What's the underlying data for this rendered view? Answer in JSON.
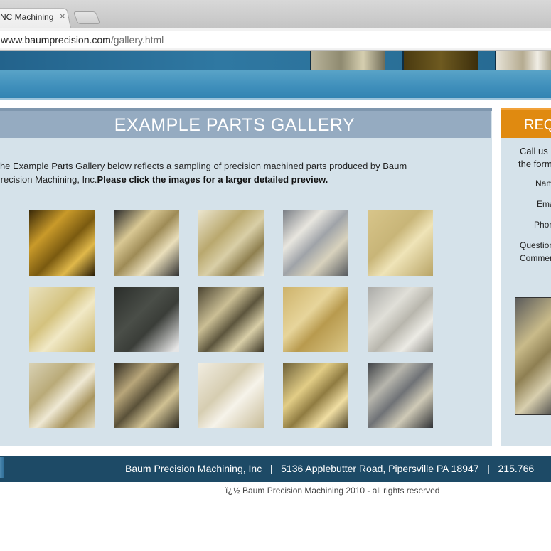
{
  "browser": {
    "tab_title": "NC Machining",
    "tab_close": "×",
    "url_host": "www.baumprecision.com",
    "url_path": "/gallery.html"
  },
  "gallery": {
    "title": "EXAMPLE PARTS GALLERY",
    "intro_text": "The Example Parts Gallery below reflects a sampling of precision machined parts produced by Baum Precision Machining, Inc.",
    "intro_bold": "Please click the images for a larger detailed preview.",
    "images": [
      {
        "alt": "gold-anodized-housing"
      },
      {
        "alt": "heatsink-chassis"
      },
      {
        "alt": "finned-heatsink-block"
      },
      {
        "alt": "aluminum-fin-assembly"
      },
      {
        "alt": "enclosure-base"
      },
      {
        "alt": "grid-pocketed-plate"
      },
      {
        "alt": "black-anodized-plate"
      },
      {
        "alt": "heatsink-corner"
      },
      {
        "alt": "slotted-plate"
      },
      {
        "alt": "fin-stack"
      },
      {
        "alt": "assorted-parts"
      },
      {
        "alt": "pocketed-chassis"
      },
      {
        "alt": "channel-plate"
      },
      {
        "alt": "machined-bracket"
      },
      {
        "alt": "mixed-assemblies"
      }
    ]
  },
  "sidebar": {
    "title": "REQ",
    "line1": "Call us",
    "line2": "the form",
    "labels": [
      "Name",
      "Email",
      "Phone",
      "Questions",
      "Comments"
    ]
  },
  "footer": {
    "text": "Baum Precision Machining, Inc   |   5136 Applebutter Road, Pipersville PA 18947   |   215.766",
    "copyright": "ï¿½ Baum Precision Machining 2010 - all rights reserved"
  },
  "colors": {
    "header_bar": "#95abc1",
    "panel_bg": "#d5e2ea",
    "accent_orange": "#e08a10",
    "footer_bg": "#1d4a66"
  }
}
